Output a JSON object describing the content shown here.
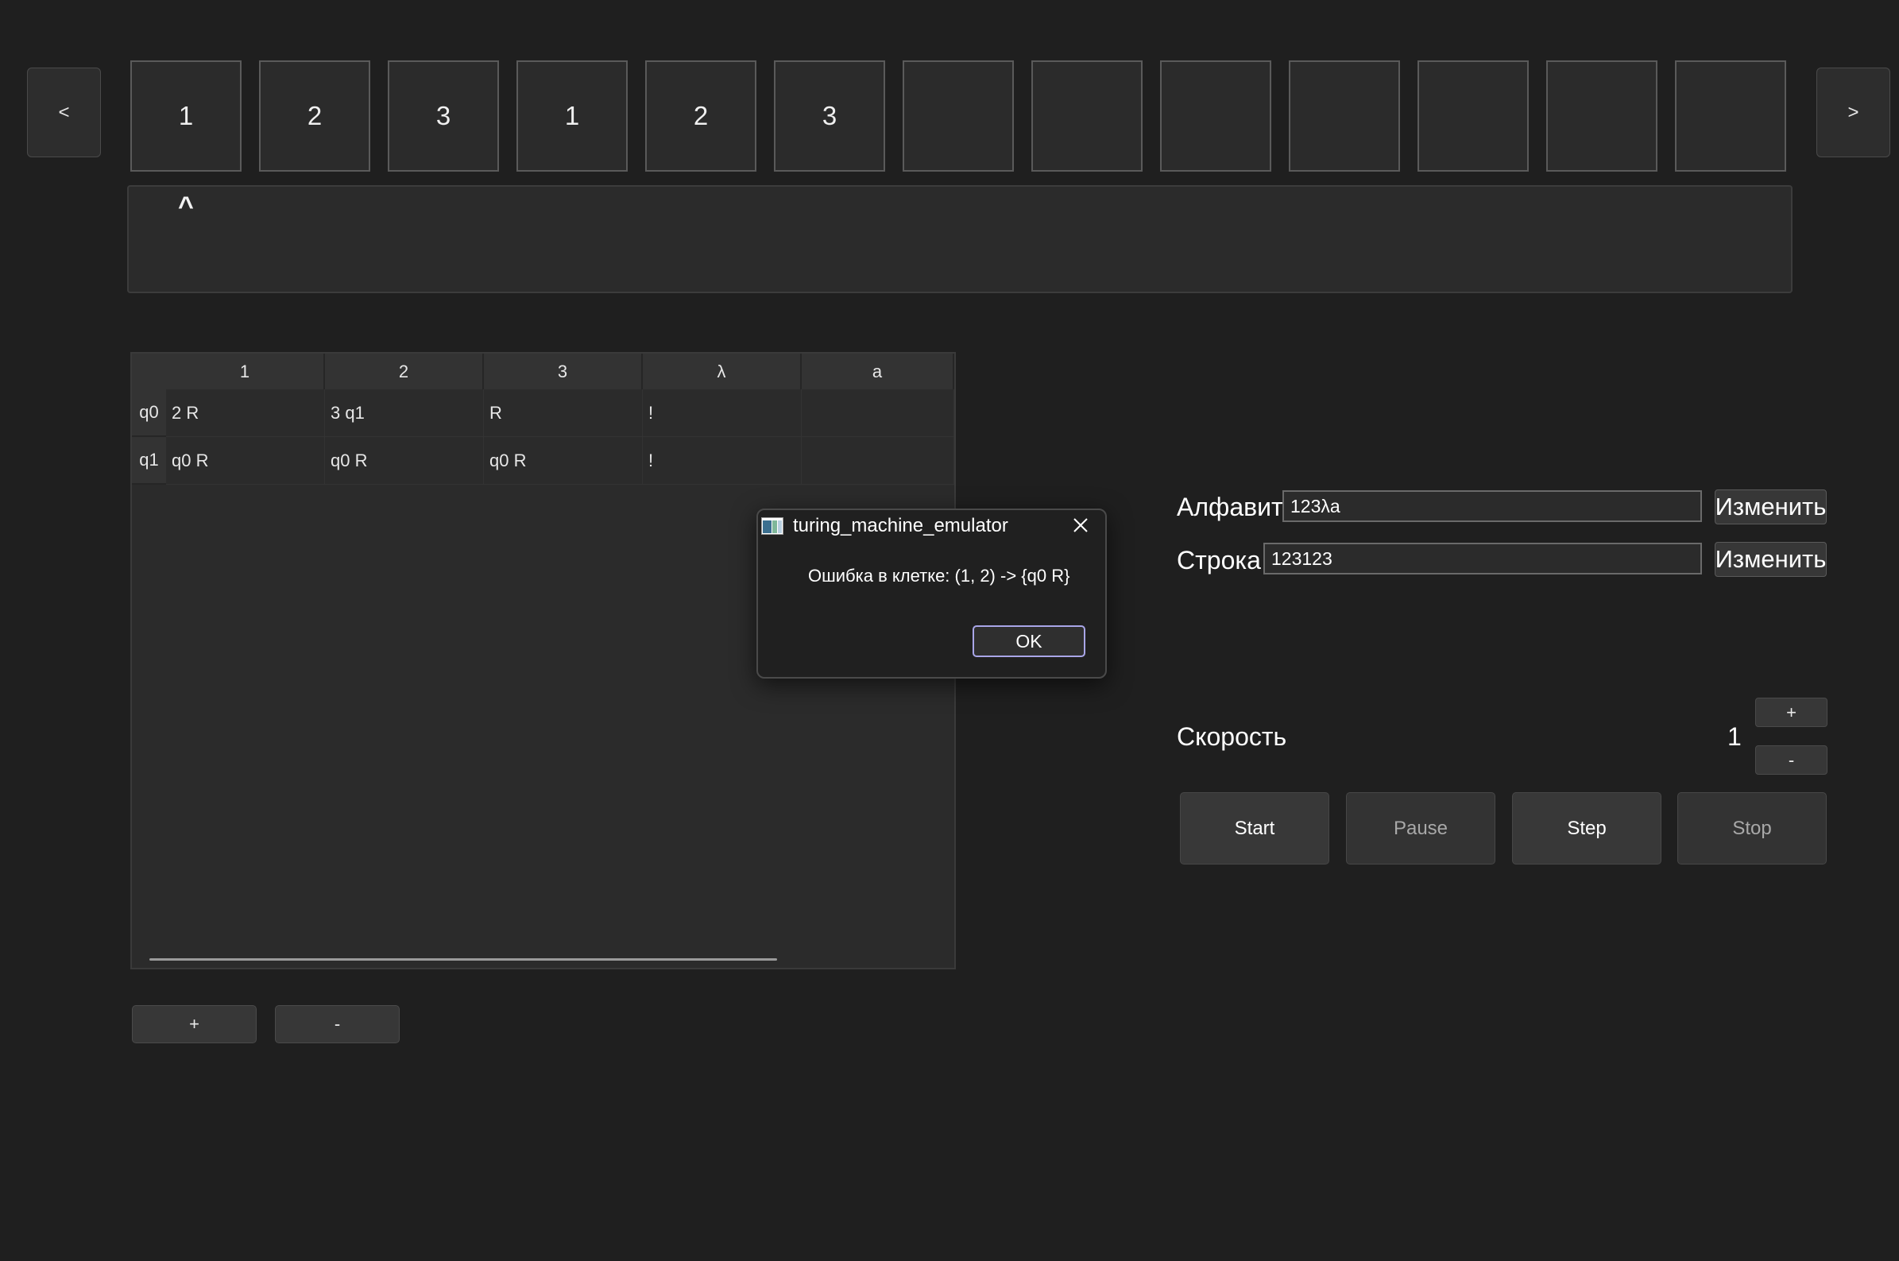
{
  "tape": {
    "prev_label": "<",
    "next_label": ">",
    "cells": [
      "1",
      "2",
      "3",
      "1",
      "2",
      "3",
      "",
      "",
      "",
      "",
      "",
      "",
      ""
    ],
    "head_marker": "^"
  },
  "table": {
    "columns": [
      "1",
      "2",
      "3",
      "λ",
      "a"
    ],
    "rows": [
      {
        "state": "q0",
        "cells": [
          "2 R",
          "3 q1",
          "R",
          "!",
          ""
        ]
      },
      {
        "state": "q1",
        "cells": [
          "q0 R",
          "q0 R",
          "q0 R",
          "!",
          ""
        ]
      }
    ],
    "add_label": "+",
    "remove_label": "-"
  },
  "settings": {
    "alphabet_label": "Алфавит",
    "alphabet_value": "123λa",
    "string_label": "Строка",
    "string_value": "123123",
    "change_label": "Изменить",
    "speed_label": "Скорость",
    "speed_value": "1",
    "speed_plus": "+",
    "speed_minus": "-"
  },
  "controls": {
    "start": "Start",
    "pause": "Pause",
    "step": "Step",
    "stop": "Stop"
  },
  "dialog": {
    "title": "turing_machine_emulator",
    "message": "Ошибка в клетке: (1, 2) -> {q0 R}",
    "ok_label": "OK",
    "icon": "app-window-icon"
  }
}
